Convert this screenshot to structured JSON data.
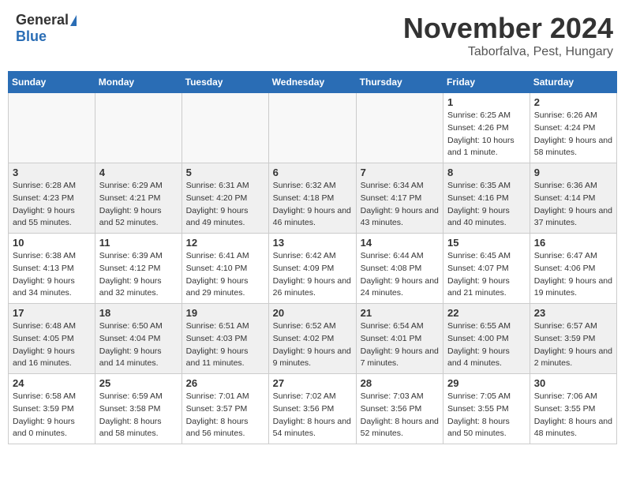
{
  "header": {
    "logo_general": "General",
    "logo_blue": "Blue",
    "title": "November 2024",
    "location": "Taborfalva, Pest, Hungary"
  },
  "days_of_week": [
    "Sunday",
    "Monday",
    "Tuesday",
    "Wednesday",
    "Thursday",
    "Friday",
    "Saturday"
  ],
  "weeks": [
    [
      {
        "day": "",
        "info": ""
      },
      {
        "day": "",
        "info": ""
      },
      {
        "day": "",
        "info": ""
      },
      {
        "day": "",
        "info": ""
      },
      {
        "day": "",
        "info": ""
      },
      {
        "day": "1",
        "info": "Sunrise: 6:25 AM\nSunset: 4:26 PM\nDaylight: 10 hours and 1 minute."
      },
      {
        "day": "2",
        "info": "Sunrise: 6:26 AM\nSunset: 4:24 PM\nDaylight: 9 hours and 58 minutes."
      }
    ],
    [
      {
        "day": "3",
        "info": "Sunrise: 6:28 AM\nSunset: 4:23 PM\nDaylight: 9 hours and 55 minutes."
      },
      {
        "day": "4",
        "info": "Sunrise: 6:29 AM\nSunset: 4:21 PM\nDaylight: 9 hours and 52 minutes."
      },
      {
        "day": "5",
        "info": "Sunrise: 6:31 AM\nSunset: 4:20 PM\nDaylight: 9 hours and 49 minutes."
      },
      {
        "day": "6",
        "info": "Sunrise: 6:32 AM\nSunset: 4:18 PM\nDaylight: 9 hours and 46 minutes."
      },
      {
        "day": "7",
        "info": "Sunrise: 6:34 AM\nSunset: 4:17 PM\nDaylight: 9 hours and 43 minutes."
      },
      {
        "day": "8",
        "info": "Sunrise: 6:35 AM\nSunset: 4:16 PM\nDaylight: 9 hours and 40 minutes."
      },
      {
        "day": "9",
        "info": "Sunrise: 6:36 AM\nSunset: 4:14 PM\nDaylight: 9 hours and 37 minutes."
      }
    ],
    [
      {
        "day": "10",
        "info": "Sunrise: 6:38 AM\nSunset: 4:13 PM\nDaylight: 9 hours and 34 minutes."
      },
      {
        "day": "11",
        "info": "Sunrise: 6:39 AM\nSunset: 4:12 PM\nDaylight: 9 hours and 32 minutes."
      },
      {
        "day": "12",
        "info": "Sunrise: 6:41 AM\nSunset: 4:10 PM\nDaylight: 9 hours and 29 minutes."
      },
      {
        "day": "13",
        "info": "Sunrise: 6:42 AM\nSunset: 4:09 PM\nDaylight: 9 hours and 26 minutes."
      },
      {
        "day": "14",
        "info": "Sunrise: 6:44 AM\nSunset: 4:08 PM\nDaylight: 9 hours and 24 minutes."
      },
      {
        "day": "15",
        "info": "Sunrise: 6:45 AM\nSunset: 4:07 PM\nDaylight: 9 hours and 21 minutes."
      },
      {
        "day": "16",
        "info": "Sunrise: 6:47 AM\nSunset: 4:06 PM\nDaylight: 9 hours and 19 minutes."
      }
    ],
    [
      {
        "day": "17",
        "info": "Sunrise: 6:48 AM\nSunset: 4:05 PM\nDaylight: 9 hours and 16 minutes."
      },
      {
        "day": "18",
        "info": "Sunrise: 6:50 AM\nSunset: 4:04 PM\nDaylight: 9 hours and 14 minutes."
      },
      {
        "day": "19",
        "info": "Sunrise: 6:51 AM\nSunset: 4:03 PM\nDaylight: 9 hours and 11 minutes."
      },
      {
        "day": "20",
        "info": "Sunrise: 6:52 AM\nSunset: 4:02 PM\nDaylight: 9 hours and 9 minutes."
      },
      {
        "day": "21",
        "info": "Sunrise: 6:54 AM\nSunset: 4:01 PM\nDaylight: 9 hours and 7 minutes."
      },
      {
        "day": "22",
        "info": "Sunrise: 6:55 AM\nSunset: 4:00 PM\nDaylight: 9 hours and 4 minutes."
      },
      {
        "day": "23",
        "info": "Sunrise: 6:57 AM\nSunset: 3:59 PM\nDaylight: 9 hours and 2 minutes."
      }
    ],
    [
      {
        "day": "24",
        "info": "Sunrise: 6:58 AM\nSunset: 3:59 PM\nDaylight: 9 hours and 0 minutes."
      },
      {
        "day": "25",
        "info": "Sunrise: 6:59 AM\nSunset: 3:58 PM\nDaylight: 8 hours and 58 minutes."
      },
      {
        "day": "26",
        "info": "Sunrise: 7:01 AM\nSunset: 3:57 PM\nDaylight: 8 hours and 56 minutes."
      },
      {
        "day": "27",
        "info": "Sunrise: 7:02 AM\nSunset: 3:56 PM\nDaylight: 8 hours and 54 minutes."
      },
      {
        "day": "28",
        "info": "Sunrise: 7:03 AM\nSunset: 3:56 PM\nDaylight: 8 hours and 52 minutes."
      },
      {
        "day": "29",
        "info": "Sunrise: 7:05 AM\nSunset: 3:55 PM\nDaylight: 8 hours and 50 minutes."
      },
      {
        "day": "30",
        "info": "Sunrise: 7:06 AM\nSunset: 3:55 PM\nDaylight: 8 hours and 48 minutes."
      }
    ]
  ]
}
